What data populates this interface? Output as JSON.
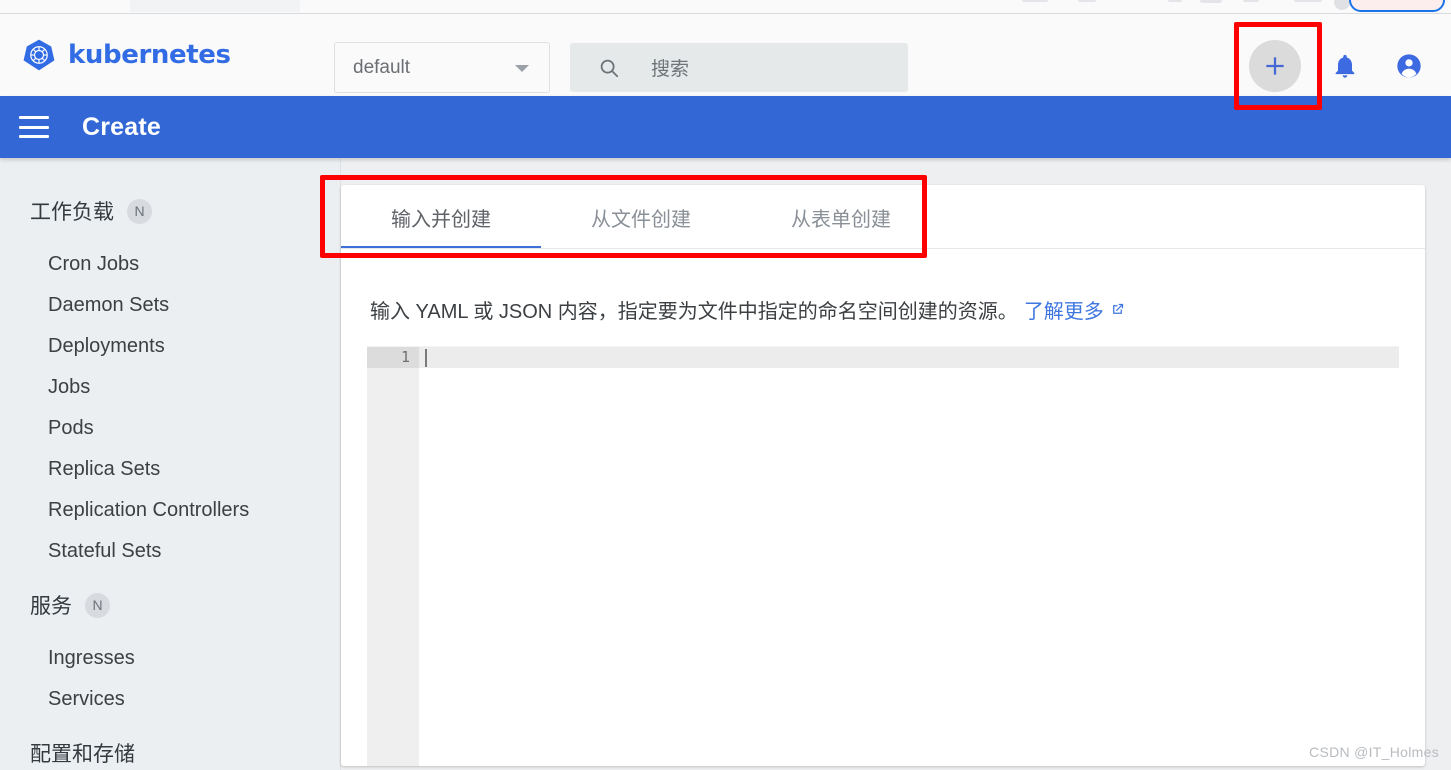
{
  "browser": {
    "omnibox_highlighted": true
  },
  "topbar": {
    "brand": "kubernetes",
    "logo_icon": "kubernetes-helm-logo",
    "namespace": {
      "selected": "default",
      "caret_icon": "chevron-down-icon"
    },
    "search": {
      "icon": "search-icon",
      "placeholder": "搜索",
      "value": ""
    },
    "create_button": {
      "icon": "plus-icon",
      "label": "+",
      "highlighted": true
    },
    "notifications_icon": "bell-icon",
    "account_icon": "account-circle-icon"
  },
  "actionbar": {
    "menu_icon": "hamburger-menu-icon",
    "title": "Create",
    "background_color": "#3367d6"
  },
  "sidebar": {
    "groups": [
      {
        "label": "工作负载",
        "badge": "N",
        "items": [
          {
            "label": "Cron Jobs"
          },
          {
            "label": "Daemon Sets"
          },
          {
            "label": "Deployments"
          },
          {
            "label": "Jobs"
          },
          {
            "label": "Pods"
          },
          {
            "label": "Replica Sets"
          },
          {
            "label": "Replication Controllers"
          },
          {
            "label": "Stateful Sets"
          }
        ]
      },
      {
        "label": "服务",
        "badge": "N",
        "items": [
          {
            "label": "Ingresses"
          },
          {
            "label": "Services"
          }
        ]
      },
      {
        "label": "配置和存储",
        "badge": "",
        "items": []
      }
    ]
  },
  "main": {
    "tabs": [
      {
        "label": "输入并创建",
        "active": true
      },
      {
        "label": "从文件创建",
        "active": false
      },
      {
        "label": "从表单创建",
        "active": false
      }
    ],
    "tabs_highlighted": true,
    "description": {
      "text": "输入 YAML 或 JSON 内容，指定要为文件中指定的命名空间创建的资源。",
      "link_label": "了解更多",
      "link_icon": "external-link-icon"
    },
    "editor": {
      "line_numbers": [
        "1"
      ],
      "lines": [
        ""
      ],
      "active_line": 1
    }
  },
  "colors": {
    "accent": "#3367d6",
    "brand": "#326ce5",
    "tab_underline": "#3f6fd8",
    "link": "#3f76e0",
    "annotation": "#fe0000"
  },
  "watermark": "CSDN @IT_Holmes"
}
